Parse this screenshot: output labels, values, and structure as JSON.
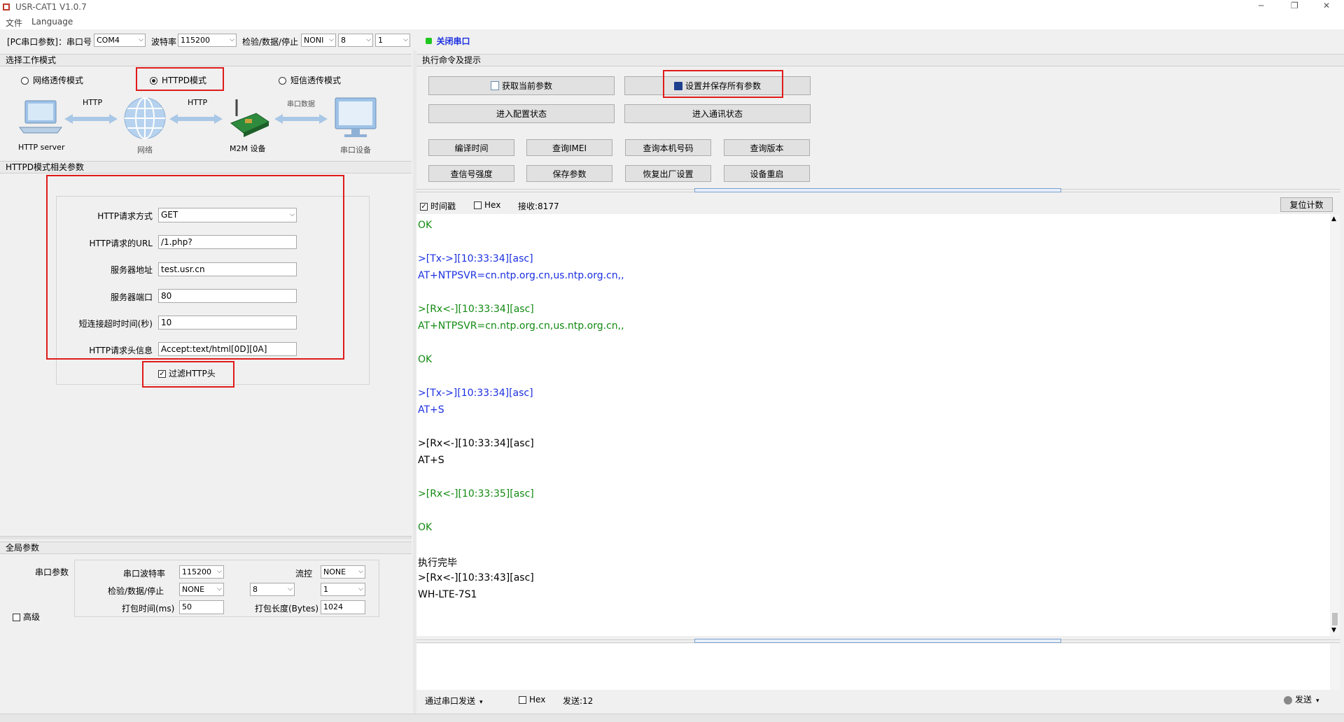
{
  "window": {
    "title": "USR-CAT1 V1.0.7",
    "menu": [
      "文件",
      "Language"
    ],
    "controls": [
      "─",
      "❐",
      "✕"
    ]
  },
  "toolbar": {
    "pc_port_label": "[PC串口参数]：串口号",
    "port_value": "COM4",
    "baud_label": "波特率",
    "baud_value": "115200",
    "check_label": "检验/数据/停止",
    "parity_value": "NONI",
    "data_value": "8",
    "stop_value": "1",
    "close_port_label": "关闭串口"
  },
  "mode_section": {
    "header": "选择工作模式",
    "modes": [
      {
        "label": "网络透传模式",
        "selected": false
      },
      {
        "label": "HTTPD模式",
        "selected": true
      },
      {
        "label": "短信透传模式",
        "selected": false
      }
    ],
    "diagram": {
      "server_label": "HTTP server",
      "link1": "HTTP",
      "network_label": "网络",
      "link2": "HTTP",
      "device_label": "M2M 设备",
      "link3": "串口数据",
      "serial_label": "串口设备"
    }
  },
  "httpd_section": {
    "header": "HTTPD模式相关参数",
    "fields": [
      {
        "label": "HTTP请求方式",
        "value": "GET",
        "type": "select"
      },
      {
        "label": "HTTP请求的URL",
        "value": "/1.php?",
        "type": "text"
      },
      {
        "label": "服务器地址",
        "value": "test.usr.cn",
        "type": "text"
      },
      {
        "label": "服务器端口",
        "value": "80",
        "type": "text"
      },
      {
        "label": "短连接超时时间(秒)",
        "value": "10",
        "type": "text"
      },
      {
        "label": "HTTP请求头信息",
        "value": "Accept:text/html[0D][0A]",
        "type": "text"
      }
    ],
    "filter_label": "过滤HTTP头",
    "filter_checked": true
  },
  "global_section": {
    "header": "全局参数",
    "serial_params_label": "串口参数",
    "baud_label": "串口波特率",
    "baud_value": "115200",
    "flow_label": "流控",
    "flow_value": "NONE",
    "check_label": "检验/数据/停止",
    "parity_value": "NONE",
    "data_value": "8",
    "stop_value": "1",
    "pack_time_label": "打包时间(ms)",
    "pack_time_value": "50",
    "pack_len_label": "打包长度(Bytes)",
    "pack_len_value": "1024",
    "advanced_label": "高级"
  },
  "cmd_section": {
    "header": "执行命令及提示",
    "buttons_row1": [
      "获取当前参数",
      "设置并保存所有参数"
    ],
    "buttons_row2": [
      "进入配置状态",
      "进入通讯状态"
    ],
    "buttons_row3": [
      "编译时间",
      "查询IMEI",
      "查询本机号码",
      "查询版本"
    ],
    "buttons_row4": [
      "查信号强度",
      "保存参数",
      "恢复出厂设置",
      "设备重启"
    ]
  },
  "log": {
    "timestamp_label": "时间戳",
    "timestamp_checked": true,
    "hex_label": "Hex",
    "recv_label": "接收:8177",
    "reset_label": "复位计数",
    "lines": [
      {
        "text": "OK",
        "color": "#128a12"
      },
      {
        "text": "",
        "color": "#000"
      },
      {
        "text": ">[Tx->][10:33:34][asc]",
        "color": "#1a2fe0"
      },
      {
        "text": "AT+NTPSVR=cn.ntp.org.cn,us.ntp.org.cn,,",
        "color": "#1a2fe0"
      },
      {
        "text": "",
        "color": "#000"
      },
      {
        "text": ">[Rx<-][10:33:34][asc]",
        "color": "#128a12"
      },
      {
        "text": "AT+NTPSVR=cn.ntp.org.cn,us.ntp.org.cn,,",
        "color": "#128a12"
      },
      {
        "text": "",
        "color": "#000"
      },
      {
        "text": "OK",
        "color": "#128a12"
      },
      {
        "text": "",
        "color": "#000"
      },
      {
        "text": ">[Tx->][10:33:34][asc]",
        "color": "#1a2fe0"
      },
      {
        "text": "AT+S",
        "color": "#1a2fe0"
      },
      {
        "text": "",
        "color": "#000"
      },
      {
        "text": ">[Rx<-][10:33:34][asc]",
        "color": "#000"
      },
      {
        "text": "AT+S",
        "color": "#000"
      },
      {
        "text": "",
        "color": "#000"
      },
      {
        "text": ">[Rx<-][10:33:35][asc]",
        "color": "#128a12"
      },
      {
        "text": "",
        "color": "#000"
      },
      {
        "text": "OK",
        "color": "#128a12"
      },
      {
        "text": "",
        "color": "#000"
      },
      {
        "text": "执行完毕",
        "color": "#000"
      },
      {
        "text": ">[Rx<-][10:33:43][asc]",
        "color": "#000"
      },
      {
        "text": "WH-LTE-7S1",
        "color": "#000"
      }
    ]
  },
  "send": {
    "via_label": "通过串口发送",
    "hex_label": "Hex",
    "sent_label": "发送:12",
    "send_label": "发送"
  }
}
